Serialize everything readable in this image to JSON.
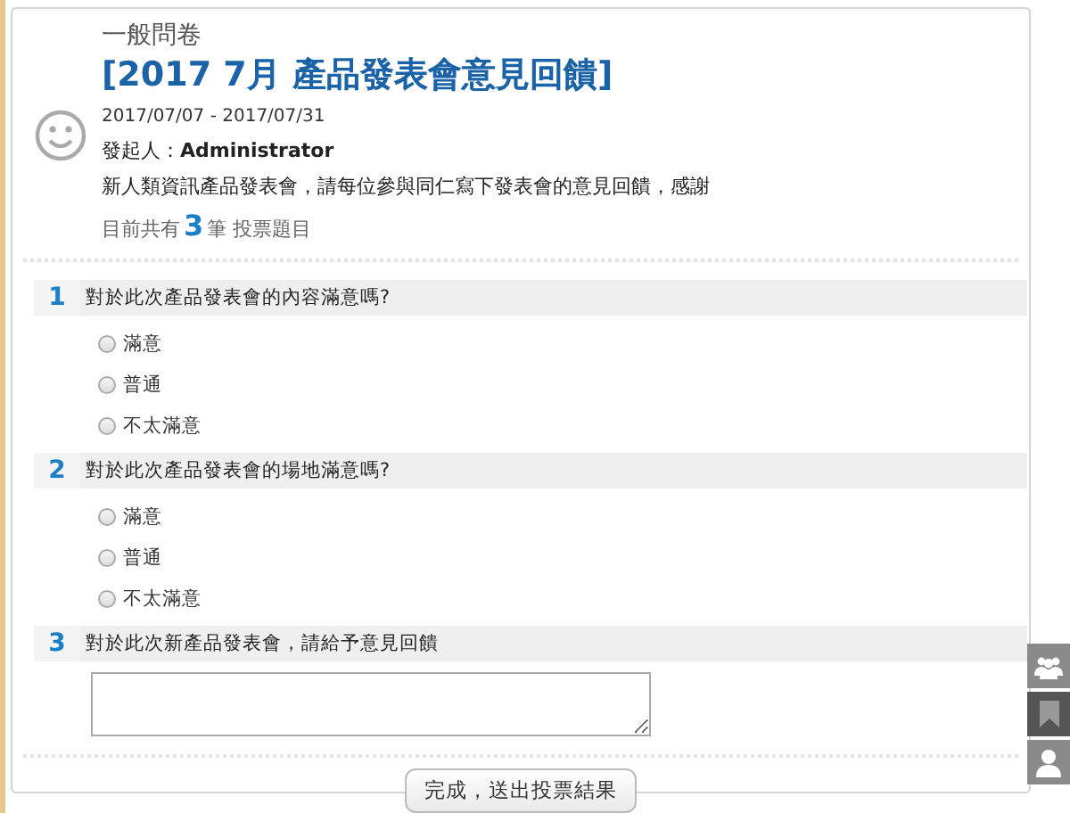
{
  "header": {
    "category": "一般問卷",
    "title": "[2017 7月 產品發表會意見回饋]",
    "dates": "2017/07/07 - 2017/07/31",
    "initiator_label": "發起人：",
    "initiator": "Administrator",
    "description": "新人類資訊產品發表會，請每位參與同仁寫下發表會的意見回饋，感謝",
    "count_prefix": "目前共有",
    "count": "3",
    "count_suffix": "筆 投票題目"
  },
  "questions": [
    {
      "number": "1",
      "kind": "choice",
      "text": "對於此次產品發表會的內容滿意嗎?",
      "options": [
        {
          "label": "滿意",
          "selected": false
        },
        {
          "label": "普通",
          "selected": false
        },
        {
          "label": "不太滿意",
          "selected": false
        }
      ]
    },
    {
      "number": "2",
      "kind": "choice",
      "text": "對於此次產品發表會的場地滿意嗎?",
      "options": [
        {
          "label": "滿意",
          "selected": false
        },
        {
          "label": "普通",
          "selected": false
        },
        {
          "label": "不太滿意",
          "selected": false
        }
      ]
    },
    {
      "number": "3",
      "kind": "text",
      "text": "對於此次新產品發表會，請給予意見回饋"
    }
  ],
  "submit": "完成，送出投票結果"
}
